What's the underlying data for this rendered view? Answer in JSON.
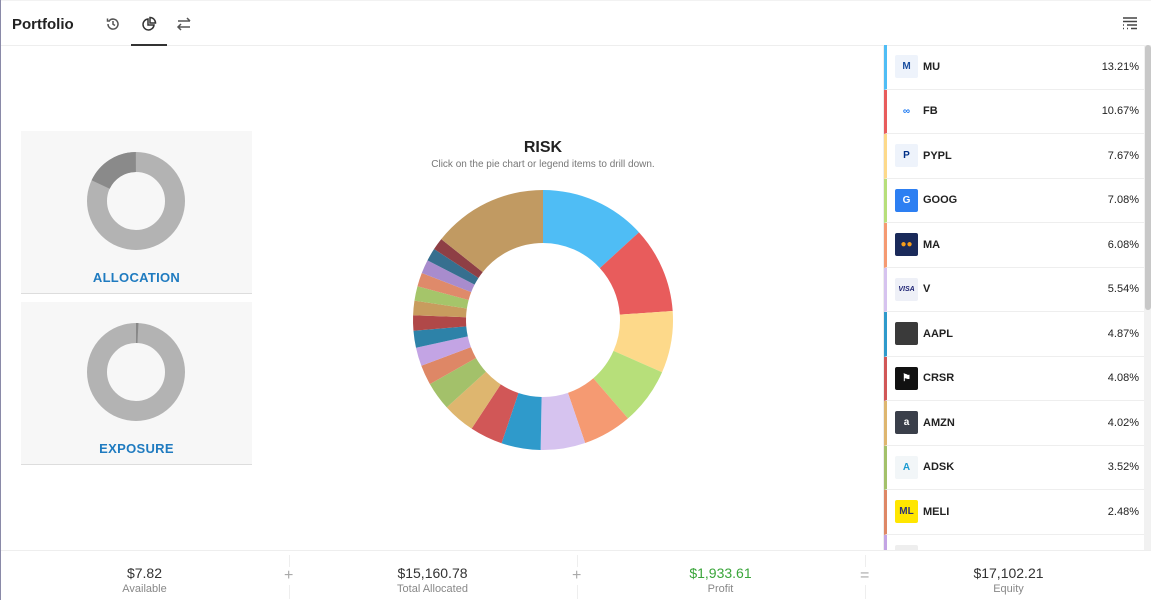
{
  "header": {
    "title": "Portfolio",
    "tabs": [
      {
        "name": "history"
      },
      {
        "name": "risk-chart",
        "active": true
      },
      {
        "name": "transfers"
      }
    ]
  },
  "cards": [
    {
      "label": "ALLOCATION",
      "fraction": 0.18
    },
    {
      "label": "EXPOSURE",
      "fraction": 0.01
    }
  ],
  "risk": {
    "title": "RISK",
    "subtitle": "Click on the pie chart or legend items to drill down."
  },
  "holdings": [
    {
      "symbol": "MU",
      "percent": "13.21%",
      "color": "#4fbdf5",
      "logo_bg": "#eef3fb",
      "logo_fg": "#1a4fa0",
      "logo": "M"
    },
    {
      "symbol": "FB",
      "percent": "10.67%",
      "color": "#e85c5c",
      "logo_bg": "#fff",
      "logo_fg": "#1877f2",
      "logo": "∞"
    },
    {
      "symbol": "PYPL",
      "percent": "7.67%",
      "color": "#fdd98a",
      "logo_bg": "#eef3fb",
      "logo_fg": "#003087",
      "logo": "P"
    },
    {
      "symbol": "GOOG",
      "percent": "7.08%",
      "color": "#b7df7a",
      "logo_bg": "#2d7ff2",
      "logo_fg": "#fff",
      "logo": "G"
    },
    {
      "symbol": "MA",
      "percent": "6.08%",
      "color": "#f59a72",
      "logo_bg": "#1a2a5a",
      "logo_fg": "#f79e1b",
      "logo": "●●"
    },
    {
      "symbol": "V",
      "percent": "5.54%",
      "color": "#d6c3ef",
      "logo_bg": "#eef0f7",
      "logo_fg": "#1a1f71",
      "logo": "VISA"
    },
    {
      "symbol": "AAPL",
      "percent": "4.87%",
      "color": "#2f9acb",
      "logo_bg": "#3a3a3a",
      "logo_fg": "#fff",
      "logo": ""
    },
    {
      "symbol": "CRSR",
      "percent": "4.08%",
      "color": "#d15757",
      "logo_bg": "#111",
      "logo_fg": "#fff",
      "logo": "⚑"
    },
    {
      "symbol": "AMZN",
      "percent": "4.02%",
      "color": "#deb66f",
      "logo_bg": "#3a3f4a",
      "logo_fg": "#fff",
      "logo": "a"
    },
    {
      "symbol": "ADSK",
      "percent": "3.52%",
      "color": "#a3c16a",
      "logo_bg": "#f2f6f8",
      "logo_fg": "#1b9bd1",
      "logo": "A"
    },
    {
      "symbol": "MELI",
      "percent": "2.48%",
      "color": "#de8766",
      "logo_bg": "#ffe600",
      "logo_fg": "#2d3277",
      "logo": "ML"
    }
  ],
  "chart_data": {
    "type": "pie",
    "title": "RISK",
    "subtitle": "Click on the pie chart or legend items to drill down.",
    "labels": [
      "MU",
      "FB",
      "PYPL",
      "GOOG",
      "MA",
      "V",
      "AAPL",
      "CRSR",
      "AMZN",
      "ADSK",
      "MELI",
      "",
      "",
      "",
      "",
      "",
      "",
      "",
      "",
      "",
      ""
    ],
    "values": [
      13.21,
      10.67,
      7.67,
      7.08,
      6.08,
      5.54,
      4.87,
      4.08,
      4.02,
      3.52,
      2.48,
      2.3,
      2.1,
      1.9,
      1.8,
      1.8,
      1.7,
      1.7,
      1.6,
      1.5,
      14.3
    ],
    "colors": [
      "#4fbdf5",
      "#e85c5c",
      "#fdd98a",
      "#b7df7a",
      "#f59a72",
      "#d6c3ef",
      "#2f9acb",
      "#d15757",
      "#deb66f",
      "#a3c16a",
      "#de8766",
      "#c3a4e4",
      "#2d82a8",
      "#b04848",
      "#c89c5e",
      "#a5c56a",
      "#df8a6a",
      "#a88ccd",
      "#366f8f",
      "#8e3f45",
      "#c19a62"
    ]
  },
  "footer": [
    {
      "value": "$7.82",
      "label": "Available",
      "op": "+"
    },
    {
      "value": "$15,160.78",
      "label": "Total Allocated",
      "op": "+"
    },
    {
      "value": "$1,933.61",
      "label": "Profit",
      "op": "=",
      "color": "#3aa53a"
    },
    {
      "value": "$17,102.21",
      "label": "Equity"
    }
  ]
}
